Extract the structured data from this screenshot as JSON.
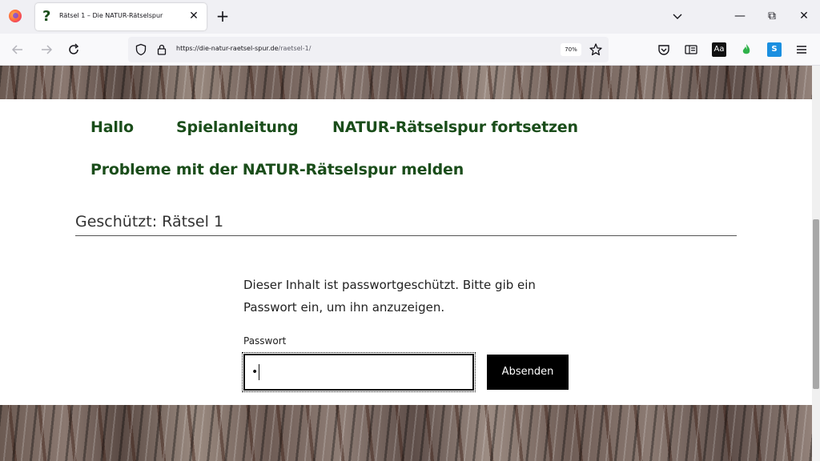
{
  "browser": {
    "tab_title": "Rätsel 1 – Die NATUR-Rätselspur",
    "tab_favicon": "?",
    "tab_close": "✕",
    "new_tab": "+",
    "tabs_list": "⌄",
    "win_minimize": "—",
    "win_restore": "⧉",
    "win_close": "✕",
    "url_domain": "https://die-natur-raetsel-spur.de",
    "url_path": "/raetsel-1/",
    "zoom": "70%",
    "icons": {
      "back": "arrow-left-icon",
      "forward": "arrow-right-icon",
      "reload": "reload-icon",
      "shield": "shield-icon",
      "lock": "lock-icon",
      "bookmark": "star-icon",
      "pocket": "pocket-icon",
      "reader": "reader-view-icon",
      "menu": "hamburger-menu-icon"
    },
    "ext_aa": "Aa",
    "ext_s": "S"
  },
  "nav": {
    "items": [
      {
        "label": "Hallo"
      },
      {
        "label": "Spielanleitung"
      },
      {
        "label": "NATUR-Rätselspur fortsetzen"
      },
      {
        "label": "Probleme mit der NATUR-Rätselspur melden"
      }
    ]
  },
  "page": {
    "title": "Geschützt: Rätsel 1",
    "protected_text": "Dieser Inhalt ist passwortgeschützt. Bitte gib ein Passwort ein, um ihn anzuzeigen.",
    "password_label": "Passwort",
    "password_value": "•",
    "submit_label": "Absenden"
  },
  "colors": {
    "nav_link": "#1a4d1a",
    "button_bg": "#000000"
  }
}
